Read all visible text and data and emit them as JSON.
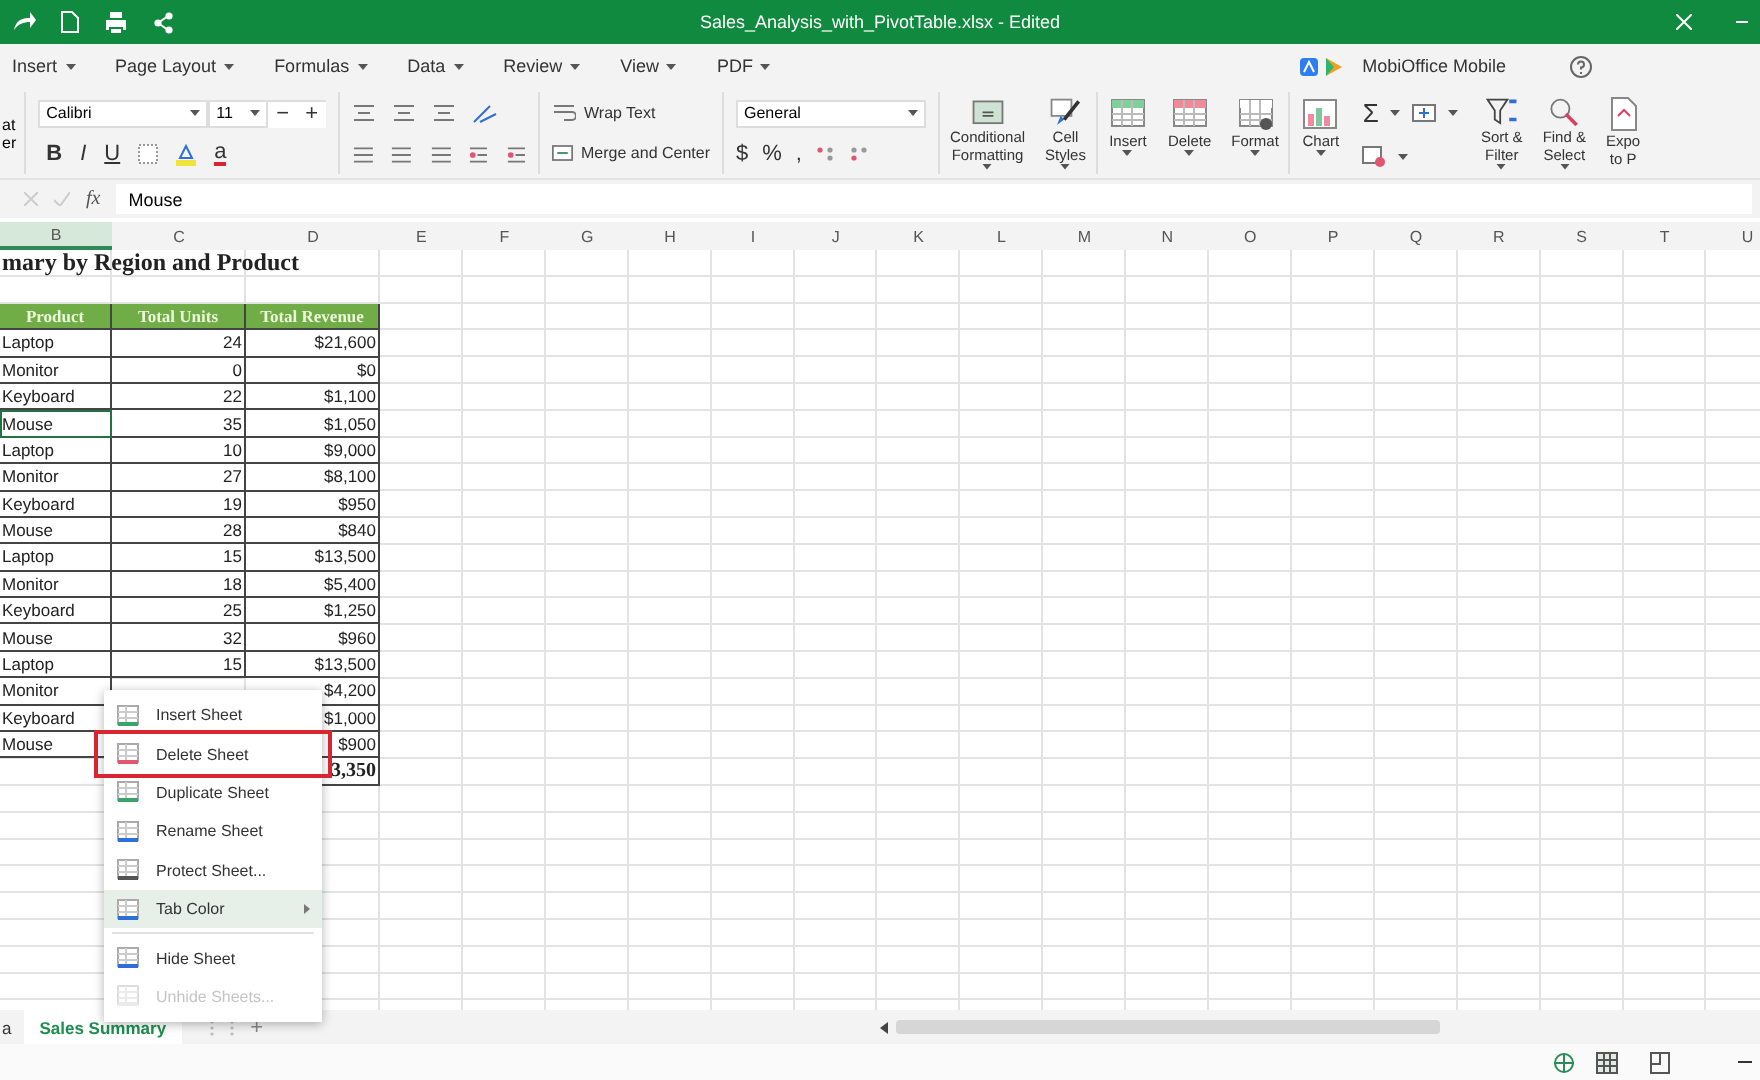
{
  "title_bar": {
    "title": "Sales_Analysis_with_PivotTable.xlsx - Edited"
  },
  "menu": [
    {
      "label": "Insert"
    },
    {
      "label": "Page Layout"
    },
    {
      "label": "Formulas"
    },
    {
      "label": "Data"
    },
    {
      "label": "Review"
    },
    {
      "label": "View"
    },
    {
      "label": "PDF"
    }
  ],
  "promo": {
    "label": "MobiOffice Mobile"
  },
  "ribbon": {
    "format_painter": [
      "at",
      "er"
    ],
    "font_name": "Calibri",
    "font_size": "11",
    "size_buttons": [
      "−",
      "+"
    ],
    "format_buttons": [
      {
        "label": "B",
        "kind": "bold"
      },
      {
        "label": "I",
        "kind": "italic"
      },
      {
        "label": "U",
        "kind": "underline"
      }
    ],
    "font_color": "a",
    "wrap_text": "Wrap Text",
    "merge_center": "Merge and Center",
    "number_format": "General",
    "number_symbols": [
      "$",
      "%",
      ","
    ],
    "sum": "Σ",
    "big_buttons": [
      {
        "kind": "conditional",
        "lines": [
          "Conditional",
          "Formatting"
        ]
      },
      {
        "kind": "styles",
        "lines": [
          "Cell",
          "Styles"
        ]
      },
      {
        "kind": "insert",
        "lines": [
          "Insert"
        ]
      },
      {
        "kind": "delete",
        "lines": [
          "Delete"
        ]
      },
      {
        "kind": "format",
        "lines": [
          "Format"
        ]
      },
      {
        "kind": "chart",
        "lines": [
          "Chart"
        ]
      },
      {
        "kind": "sum"
      },
      {
        "kind": "sort",
        "lines": [
          "Sort &",
          "Filter"
        ]
      },
      {
        "kind": "find",
        "lines": [
          "Find &",
          "Select"
        ]
      },
      {
        "kind": "export",
        "lines": [
          "Expo",
          "to P"
        ]
      }
    ]
  },
  "formula_bar": {
    "fx": "fx",
    "value": "Mouse"
  },
  "columns": [
    {
      "label": "B",
      "selected": true
    },
    {
      "label": "C",
      "selected": false
    },
    {
      "label": "D",
      "selected": false
    },
    {
      "label": "E",
      "selected": false
    },
    {
      "label": "F",
      "selected": false
    },
    {
      "label": "G",
      "selected": false
    },
    {
      "label": "H",
      "selected": false
    },
    {
      "label": "I",
      "selected": false
    },
    {
      "label": "J",
      "selected": false
    },
    {
      "label": "K",
      "selected": false
    },
    {
      "label": "L",
      "selected": false
    },
    {
      "label": "M",
      "selected": false
    },
    {
      "label": "N",
      "selected": false
    },
    {
      "label": "O",
      "selected": false
    },
    {
      "label": "P",
      "selected": false
    },
    {
      "label": "Q",
      "selected": false
    },
    {
      "label": "R",
      "selected": false
    },
    {
      "label": "S",
      "selected": false
    },
    {
      "label": "T",
      "selected": false
    },
    {
      "label": "U",
      "selected": false
    }
  ],
  "sheet": {
    "title": "mary by Region and Product",
    "headers": [
      "Product",
      "Total Units",
      "Total Revenue"
    ],
    "rows": [
      {
        "product": "Laptop",
        "units": "24",
        "revenue": "$21,600",
        "selected": false
      },
      {
        "product": "Monitor",
        "units": "0",
        "revenue": "$0",
        "selected": false
      },
      {
        "product": "Keyboard",
        "units": "22",
        "revenue": "$1,100",
        "selected": false
      },
      {
        "product": "Mouse",
        "units": "35",
        "revenue": "$1,050",
        "selected": true
      },
      {
        "product": "Laptop",
        "units": "10",
        "revenue": "$9,000",
        "selected": false
      },
      {
        "product": "Monitor",
        "units": "27",
        "revenue": "$8,100",
        "selected": false
      },
      {
        "product": "Keyboard",
        "units": "19",
        "revenue": "$950",
        "selected": false
      },
      {
        "product": "Mouse",
        "units": "28",
        "revenue": "$840",
        "selected": false
      },
      {
        "product": "Laptop",
        "units": "15",
        "revenue": "$13,500",
        "selected": false
      },
      {
        "product": "Monitor",
        "units": "18",
        "revenue": "$5,400",
        "selected": false
      },
      {
        "product": "Keyboard",
        "units": "25",
        "revenue": "$1,250",
        "selected": false
      },
      {
        "product": "Mouse",
        "units": "32",
        "revenue": "$960",
        "selected": false
      },
      {
        "product": "Laptop",
        "units": "15",
        "revenue": "$13,500",
        "selected": false
      },
      {
        "product": "Monitor",
        "revenue": "$4,200",
        "selected": false
      },
      {
        "product": "Keyboard",
        "revenue": "$1,000",
        "selected": false
      },
      {
        "product": "Mouse",
        "revenue": "$900",
        "selected": false
      }
    ],
    "total": "3,350"
  },
  "context_menu": {
    "items": [
      {
        "label": "Insert Sheet",
        "kind": "insert",
        "highlighted": false,
        "hovered": false,
        "disabled": false
      },
      {
        "label": "Delete Sheet",
        "kind": "delete",
        "highlighted": true,
        "hovered": false,
        "disabled": false
      },
      {
        "label": "Duplicate Sheet",
        "kind": "duplicate",
        "highlighted": false,
        "hovered": false,
        "disabled": false
      },
      {
        "label": "Rename Sheet",
        "kind": "rename",
        "highlighted": false,
        "hovered": false,
        "disabled": false
      },
      {
        "label": "Protect Sheet...",
        "kind": "protect",
        "highlighted": false,
        "hovered": false,
        "disabled": false
      },
      {
        "label": "Tab Color",
        "kind": "color",
        "highlighted": false,
        "hovered": true,
        "disabled": false,
        "submenu": true
      },
      {
        "label": "Hide Sheet",
        "kind": "hide",
        "highlighted": false,
        "hovered": false,
        "disabled": false,
        "divider_before": true
      },
      {
        "label": "Unhide Sheets...",
        "kind": "unhide",
        "highlighted": false,
        "hovered": false,
        "disabled": true
      }
    ]
  },
  "sheet_tabs": [
    {
      "label": "a",
      "selected": false
    },
    {
      "label": "Sales Summary",
      "selected": true
    }
  ],
  "add_sheet": "+"
}
